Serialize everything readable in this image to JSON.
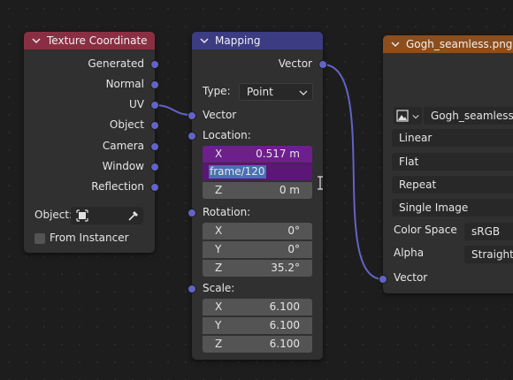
{
  "colors": {
    "texcoord_header": "#8a2f43",
    "mapping_header": "#3c3c83",
    "image_header": "#8c4e1d",
    "socket_vector": "#6363c7",
    "purple_field": "#6d1f8c",
    "edit_selection": "#4772b3"
  },
  "texture_coordinate": {
    "title": "Texture Coordinate",
    "outputs": [
      "Generated",
      "Normal",
      "UV",
      "Object",
      "Camera",
      "Window",
      "Reflection"
    ],
    "object_label": "Object:",
    "from_instancer": "From Instancer"
  },
  "mapping": {
    "title": "Mapping",
    "output_vector": "Vector",
    "type_label": "Type:",
    "type_value": "Point",
    "input_vector": "Vector",
    "location_label": "Location:",
    "location": {
      "x_label": "X",
      "x_value": "0.517 m",
      "y_edit_text": "frame/120",
      "z_label": "Z",
      "z_value": "0 m"
    },
    "rotation_label": "Rotation:",
    "rotation": {
      "x_label": "X",
      "x_value": "0°",
      "y_label": "Y",
      "y_value": "0°",
      "z_label": "Z",
      "z_value": "35.2°"
    },
    "scale_label": "Scale:",
    "scale": {
      "x_label": "X",
      "x_value": "6.100",
      "y_label": "Y",
      "y_value": "6.100",
      "z_label": "Z",
      "z_value": "6.100"
    }
  },
  "image_texture": {
    "title": "Gogh_seamless.png",
    "image_name": "Gogh_seamless...",
    "interpolation": "Linear",
    "projection": "Flat",
    "extension": "Repeat",
    "source": "Single Image",
    "color_space_label": "Color Space",
    "color_space_value": "sRGB",
    "alpha_label": "Alpha",
    "alpha_value": "Straight",
    "input_vector": "Vector"
  }
}
